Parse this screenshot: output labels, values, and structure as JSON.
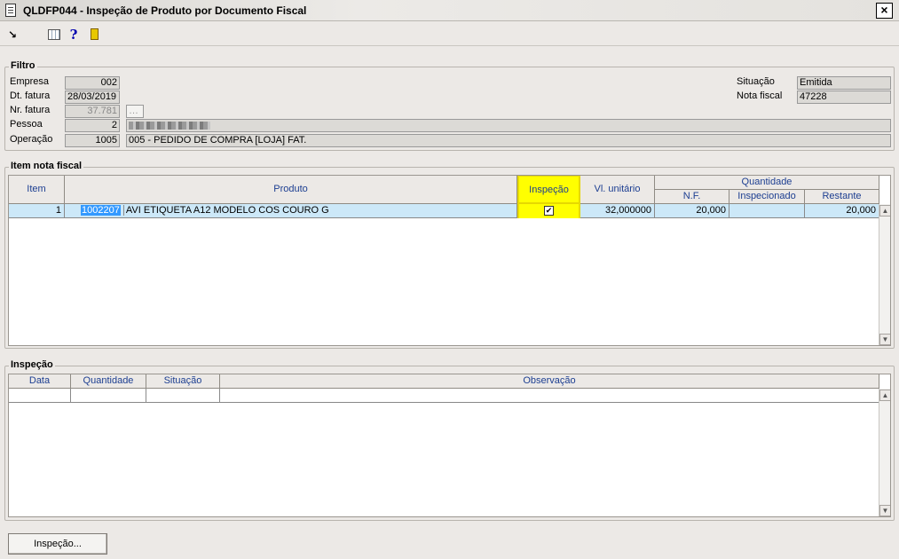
{
  "window": {
    "title": "QLDFP044 - Inspeção de Produto por Documento Fiscal",
    "close_glyph": "×"
  },
  "toolbar": {
    "icons": [
      "exit-arrow-icon",
      "grid-icon",
      "help-icon",
      "door-icon"
    ],
    "help_glyph": "?",
    "exit_glyph": "↘"
  },
  "filtro": {
    "legend": "Filtro",
    "empresa": {
      "label": "Empresa",
      "value": "002"
    },
    "dt_fatura": {
      "label": "Dt. fatura",
      "value": "28/03/2019"
    },
    "nr_fatura": {
      "label": "Nr. fatura",
      "value": "37.781"
    },
    "pessoa": {
      "label": "Pessoa",
      "value": "2"
    },
    "operacao": {
      "label": "Operação",
      "code": "1005",
      "description": "005 - PEDIDO DE COMPRA [LOJA] FAT."
    },
    "situacao": {
      "label": "Situação",
      "value": "Emitida"
    },
    "nota_fiscal": {
      "label": "Nota fiscal",
      "value": "47228"
    }
  },
  "item_nota": {
    "legend": "Item nota fiscal",
    "headers": {
      "item": "Item",
      "produto": "Produto",
      "inspecao": "Inspeção",
      "vl_unitario": "Vl. unitário",
      "quantidade": "Quantidade",
      "nf": "N.F.",
      "inspecionado": "Inspecionado",
      "restante": "Restante"
    },
    "rows": [
      {
        "item": "1",
        "codigo": "1002207",
        "descricao": "AVI ETIQUETA A12 MODELO COS COURO G",
        "inspecao_checked": true,
        "vl_unitario": "32,000000",
        "nf": "20,000",
        "inspecionado": "",
        "restante": "20,000"
      }
    ],
    "highlight_color": "#ffff00",
    "selection_color": "#cce8f8"
  },
  "inspecao": {
    "legend": "Inspeção",
    "headers": {
      "data": "Data",
      "quantidade": "Quantidade",
      "situacao": "Situação",
      "observacao": "Observação"
    }
  },
  "buttons": {
    "inspecao": "Inspeção..."
  }
}
